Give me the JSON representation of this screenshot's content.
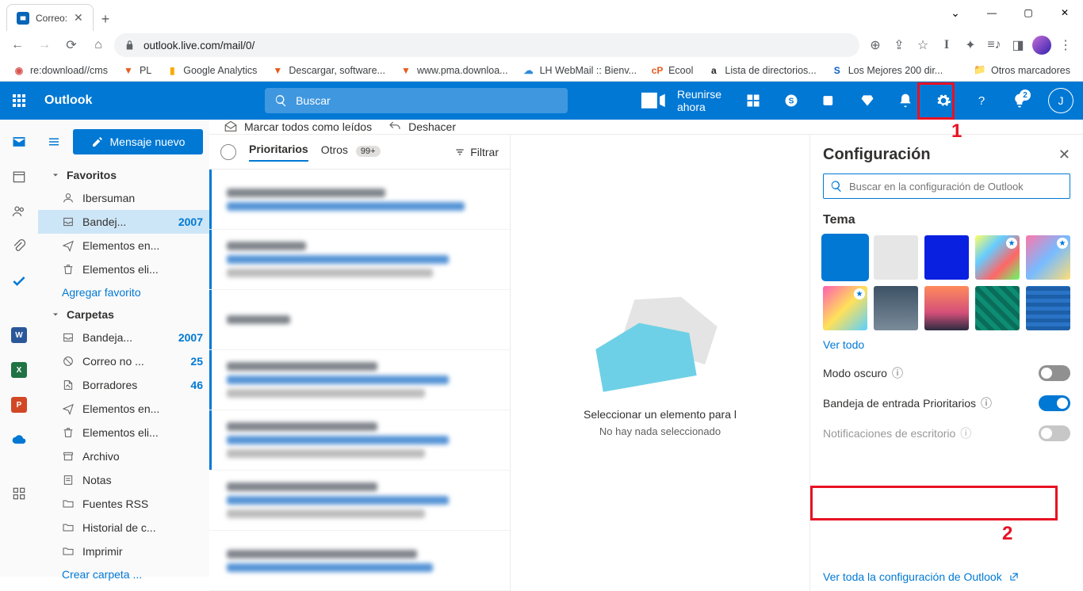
{
  "browser": {
    "tab_title": "Correo:",
    "url": "outlook.live.com/mail/0/",
    "bookmarks": [
      {
        "label": "re:download//cms",
        "color": "#d9534f",
        "icon": "circle"
      },
      {
        "label": "PL",
        "color": "#e75b1e",
        "icon": "sq"
      },
      {
        "label": "Google Analytics",
        "color": "#f9ab00",
        "icon": "bars"
      },
      {
        "label": "Descargar, software...",
        "color": "#e75b1e",
        "icon": "sq"
      },
      {
        "label": "www.pma.downloa...",
        "color": "#e75b1e",
        "icon": "sq"
      },
      {
        "label": "LH WebMail :: Bienv...",
        "color": "#2e8bdb",
        "icon": "cloud"
      },
      {
        "label": "Ecool",
        "color": "#e75b1e",
        "icon": "cp"
      },
      {
        "label": "Lista de directorios...",
        "color": "#222",
        "icon": "a"
      },
      {
        "label": "Los Mejores 200 dir...",
        "color": "#0a5fbf",
        "icon": "s"
      }
    ],
    "other_bookmarks": "Otros marcadores"
  },
  "header": {
    "brand": "Outlook",
    "search_placeholder": "Buscar",
    "meet": "Reunirse ahora",
    "tips_badge": "2",
    "avatar_initial": "J"
  },
  "compose_button": "Mensaje nuevo",
  "commands": {
    "mark_all": "Marcar todos como leídos",
    "undo": "Deshacer"
  },
  "nav": {
    "favorites_title": "Favoritos",
    "favorites": [
      {
        "label": "Ibersuman",
        "count": "",
        "icon": "person"
      },
      {
        "label": "Bandej...",
        "count": "2007",
        "icon": "inbox",
        "selected": true
      },
      {
        "label": "Elementos en...",
        "count": "",
        "icon": "sent"
      },
      {
        "label": "Elementos eli...",
        "count": "",
        "icon": "trash"
      }
    ],
    "add_favorite": "Agregar favorito",
    "folders_title": "Carpetas",
    "folders": [
      {
        "label": "Bandeja...",
        "count": "2007",
        "icon": "inbox"
      },
      {
        "label": "Correo no ...",
        "count": "25",
        "icon": "junk"
      },
      {
        "label": "Borradores",
        "count": "46",
        "icon": "draft"
      },
      {
        "label": "Elementos en...",
        "count": "",
        "icon": "sent"
      },
      {
        "label": "Elementos eli...",
        "count": "",
        "icon": "trash"
      },
      {
        "label": "Archivo",
        "count": "",
        "icon": "archive"
      },
      {
        "label": "Notas",
        "count": "",
        "icon": "note"
      },
      {
        "label": "Fuentes RSS",
        "count": "",
        "icon": "folder"
      },
      {
        "label": "Historial de c...",
        "count": "",
        "icon": "folder"
      },
      {
        "label": "Imprimir",
        "count": "",
        "icon": "folder"
      }
    ],
    "create_folder": "Crear carpeta ..."
  },
  "msglist": {
    "pivot_focused": "Prioritarios",
    "pivot_other": "Otros",
    "other_badge": "99+",
    "filter": "Filtrar"
  },
  "reading": {
    "line1": "Seleccionar un elemento para l",
    "line2": "No hay nada seleccionado"
  },
  "settings": {
    "title": "Configuración",
    "search_placeholder": "Buscar en la configuración de Outlook",
    "theme_title": "Tema",
    "view_all": "Ver todo",
    "dark_mode": "Modo oscuro",
    "focused_inbox": "Bandeja de entrada Prioritarios",
    "desktop_notif": "Notificaciones de escritorio",
    "all_settings": "Ver toda la configuración de Outlook"
  },
  "annotations": {
    "one": "1",
    "two": "2"
  }
}
